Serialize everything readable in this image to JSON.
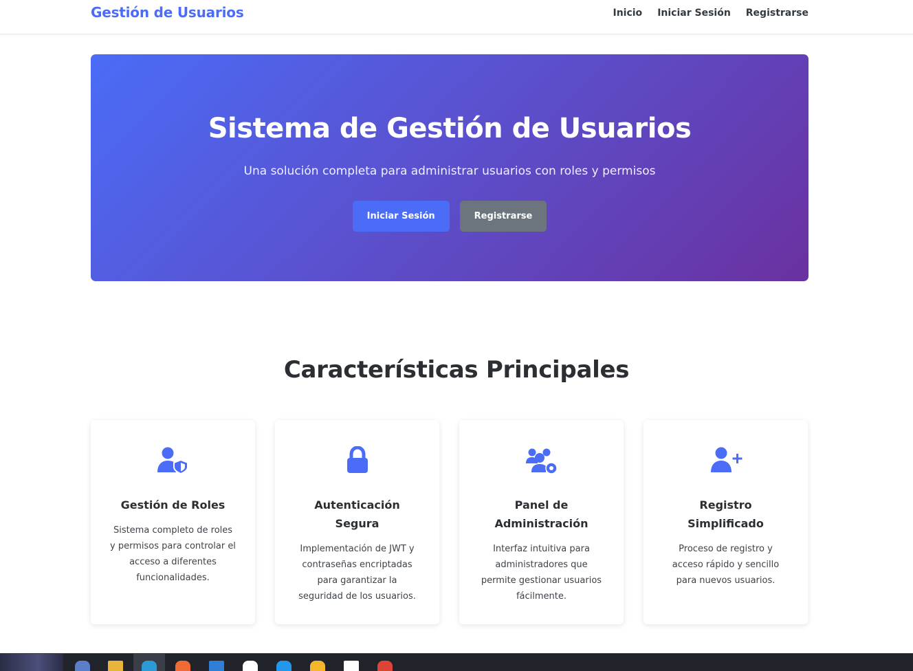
{
  "navbar": {
    "brand": "Gestión de Usuarios",
    "links": [
      "Inicio",
      "Iniciar Sesión",
      "Registrarse"
    ]
  },
  "hero": {
    "title": "Sistema de Gestión de Usuarios",
    "subtitle": "Una solución completa para administrar usuarios con roles y permisos",
    "primary_button": "Iniciar Sesión",
    "secondary_button": "Registrarse"
  },
  "features": {
    "title": "Características Principales",
    "cards": [
      {
        "icon": "user-shield-icon",
        "title": "Gestión de Roles",
        "text": "Sistema completo de roles y permisos para controlar el acceso a diferentes funcionalidades."
      },
      {
        "icon": "lock-icon",
        "title": "Autenticación Segura",
        "text": "Implementación de JWT y contraseñas encriptadas para garantizar la seguridad de los usuarios."
      },
      {
        "icon": "users-cog-icon",
        "title": "Panel de Administración",
        "text": "Interfaz intuitiva para administradores que permite gestionar usuarios fácilmente."
      },
      {
        "icon": "user-plus-icon",
        "title": "Registro Simplificado",
        "text": "Proceso de registro y acceso rápido y sencillo para nuevos usuarios."
      }
    ]
  },
  "colors": {
    "accent": "#4a6cf7",
    "secondary": "#6c757d",
    "gradient_end": "#6a31a0"
  },
  "taskbar": {
    "icons": [
      "start-icon",
      "browser-icon",
      "file-explorer-icon",
      "edge-icon",
      "postman-icon",
      "vscode-icon",
      "mongodb-icon",
      "docker-icon",
      "duck-icon",
      "app-icon",
      "chrome-icon"
    ]
  }
}
